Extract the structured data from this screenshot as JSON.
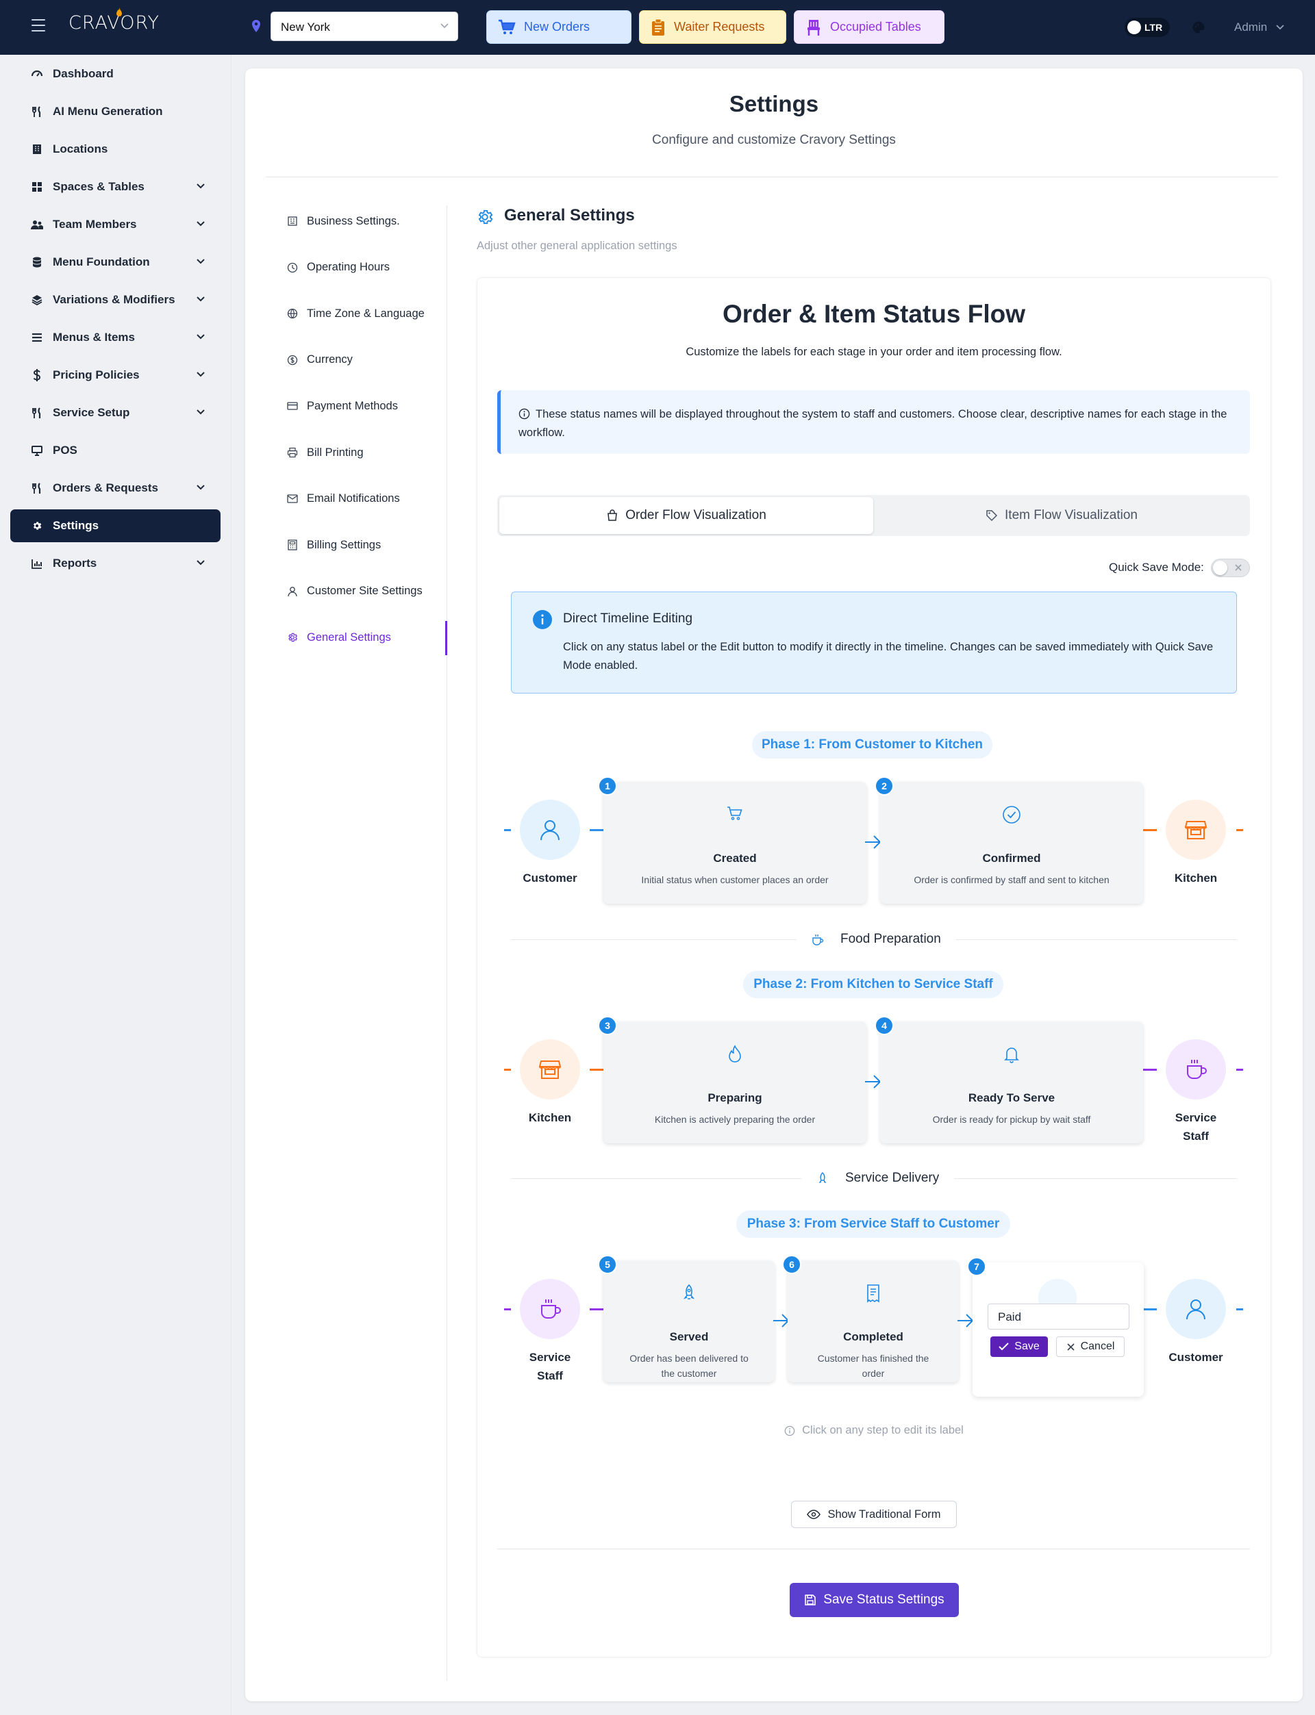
{
  "app": {
    "name": "CRAVORY"
  },
  "topbar": {
    "location": "New York",
    "buttons": {
      "new_orders": "New Orders",
      "waiter_requests": "Waiter Requests",
      "occupied_tables": "Occupied Tables"
    },
    "direction": "LTR",
    "user": "Admin"
  },
  "sidebar": {
    "items": [
      {
        "label": "Dashboard",
        "icon": "gauge-icon",
        "has_children": false
      },
      {
        "label": "AI Menu Generation",
        "icon": "utensils-icon",
        "has_children": false
      },
      {
        "label": "Locations",
        "icon": "building-icon",
        "has_children": false
      },
      {
        "label": "Spaces & Tables",
        "icon": "grid-icon",
        "has_children": true
      },
      {
        "label": "Team Members",
        "icon": "users-icon",
        "has_children": true
      },
      {
        "label": "Menu Foundation",
        "icon": "database-icon",
        "has_children": true
      },
      {
        "label": "Variations & Modifiers",
        "icon": "layers-icon",
        "has_children": true
      },
      {
        "label": "Menus & Items",
        "icon": "list-icon",
        "has_children": true
      },
      {
        "label": "Pricing Policies",
        "icon": "dollar-icon",
        "has_children": true
      },
      {
        "label": "Service Setup",
        "icon": "utensils-icon",
        "has_children": true
      },
      {
        "label": "POS",
        "icon": "monitor-icon",
        "has_children": false
      },
      {
        "label": "Orders & Requests",
        "icon": "utensils-icon",
        "has_children": true
      },
      {
        "label": "Settings",
        "icon": "gear-icon",
        "has_children": false,
        "active": true
      },
      {
        "label": "Reports",
        "icon": "chart-icon",
        "has_children": true
      }
    ]
  },
  "page": {
    "title": "Settings",
    "subtitle": "Configure and customize Cravory Settings"
  },
  "settings_nav": [
    {
      "label": "Business Settings.",
      "icon": "building-icon"
    },
    {
      "label": "Operating Hours",
      "icon": "clock-icon"
    },
    {
      "label": "Time Zone & Language",
      "icon": "globe-icon"
    },
    {
      "label": "Currency",
      "icon": "dollar-circle-icon"
    },
    {
      "label": "Payment Methods",
      "icon": "credit-card-icon"
    },
    {
      "label": "Bill Printing",
      "icon": "printer-icon"
    },
    {
      "label": "Email Notifications",
      "icon": "envelope-icon"
    },
    {
      "label": "Billing Settings",
      "icon": "calculator-icon"
    },
    {
      "label": "Customer Site Settings",
      "icon": "user-icon"
    },
    {
      "label": "General Settings",
      "icon": "gear-icon",
      "active": true
    }
  ],
  "general": {
    "title": "General Settings",
    "subtitle": "Adjust other general application settings"
  },
  "flow": {
    "title": "Order & Item Status Flow",
    "subtitle": "Customize the labels for each stage in your order and item processing flow.",
    "info": "These status names will be displayed throughout the system to staff and customers. Choose clear, descriptive names for each stage in the workflow.",
    "tabs": {
      "order": "Order Flow Visualization",
      "item": "Item Flow Visualization"
    },
    "quick_save_label": "Quick Save Mode:",
    "direct": {
      "title": "Direct Timeline Editing",
      "text": "Click on any status label or the Edit button to modify it directly in the timeline. Changes can be saved immediately with Quick Save Mode enabled."
    },
    "phases": [
      {
        "title": "Phase 1: From Customer to Kitchen",
        "start": "Customer",
        "end": "Kitchen",
        "steps": [
          {
            "num": "1",
            "title": "Created",
            "desc": "Initial status when customer places an order"
          },
          {
            "num": "2",
            "title": "Confirmed",
            "desc": "Order is confirmed by staff and sent to kitchen"
          }
        ]
      },
      {
        "title": "Phase 2: From Kitchen to Service Staff",
        "start": "Kitchen",
        "end": "Service Staff",
        "steps": [
          {
            "num": "3",
            "title": "Preparing",
            "desc": "Kitchen is actively preparing the order"
          },
          {
            "num": "4",
            "title": "Ready To Serve",
            "desc": "Order is ready for pickup by wait staff"
          }
        ]
      },
      {
        "title": "Phase 3: From Service Staff to Customer",
        "start": "Service Staff",
        "end": "Customer",
        "steps": [
          {
            "num": "5",
            "title": "Served",
            "desc": "Order has been delivered to the customer"
          },
          {
            "num": "6",
            "title": "Completed",
            "desc": "Customer has finished the order"
          }
        ]
      }
    ],
    "separators": {
      "food": "Food Preparation",
      "delivery": "Service Delivery"
    },
    "edit": {
      "value": "Paid",
      "save": "Save",
      "cancel": "Cancel"
    },
    "hint": "Click on any step to edit its label",
    "show_form": "Show Traditional Form",
    "save_button": "Save Status Settings"
  },
  "colors": {
    "navy": "#14213d",
    "accent_purple": "#5b3fcf",
    "phase_blue": "#2e90ea",
    "orange": "#f97316",
    "purple": "#9333ea"
  }
}
